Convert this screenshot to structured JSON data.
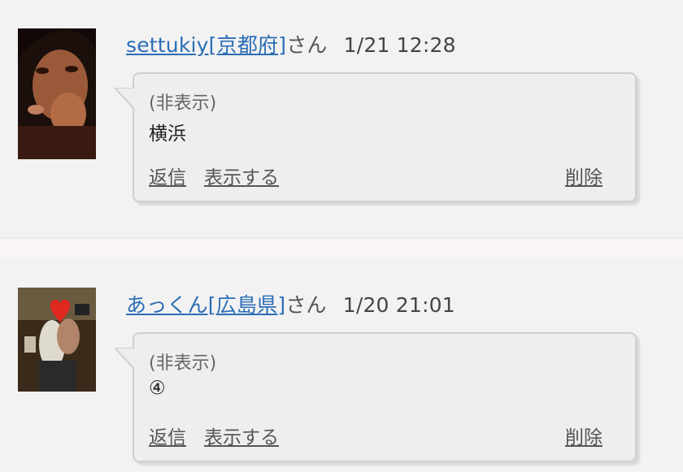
{
  "comments": [
    {
      "user": "settukiy[京都府]",
      "suffix": "さん",
      "date": "1/21 12:28",
      "hidden_label": "(非表示)",
      "body": "横浜",
      "actions": {
        "reply": "返信",
        "show": "表示する",
        "delete": "削除"
      }
    },
    {
      "user": "あっくん[広島県]",
      "suffix": "さん",
      "date": "1/20 21:01",
      "hidden_label": "(非表示)",
      "body": "④",
      "actions": {
        "reply": "返信",
        "show": "表示する",
        "delete": "削除"
      }
    }
  ],
  "colors": {
    "link": "#2a6db5",
    "bubble_bg": "#eeeeee",
    "bubble_border": "#cfcfcf"
  }
}
